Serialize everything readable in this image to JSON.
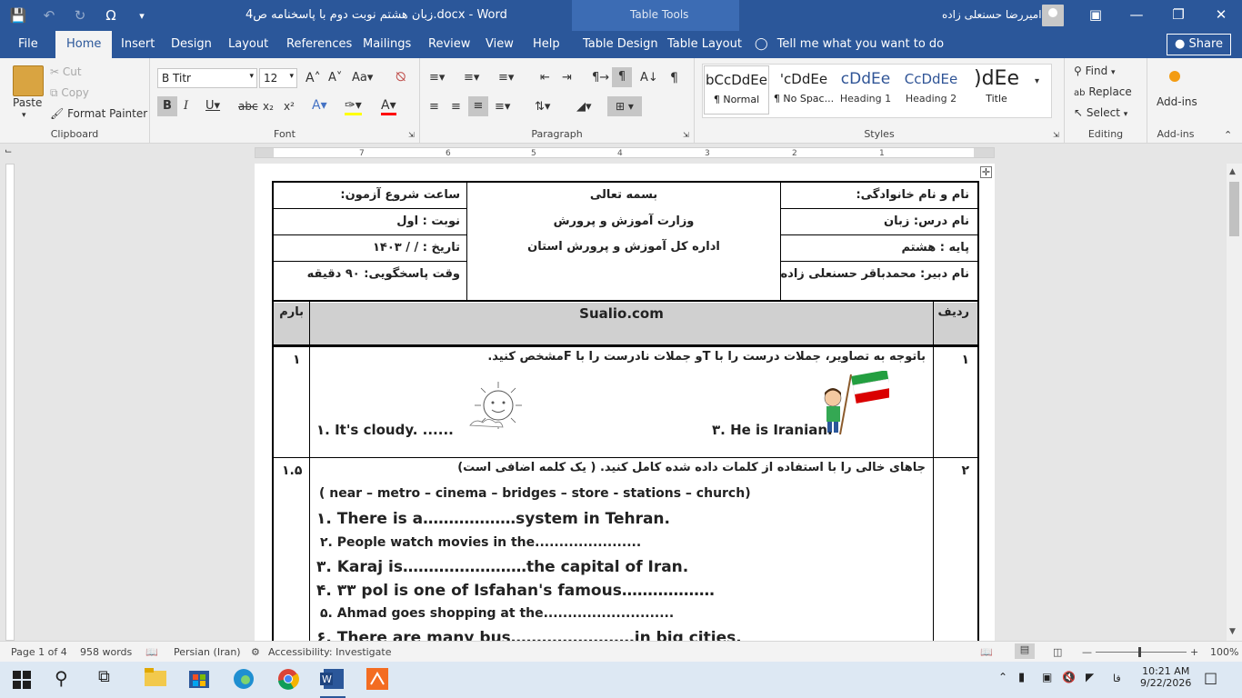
{
  "titlebar": {
    "doc_title": "زبان هشتم نوبت دوم با پاسخنامه ص4.docx  -  Word",
    "tools_title": "Table Tools",
    "user_name": "امیررضا حسنعلی زاده"
  },
  "tabs": [
    "File",
    "Home",
    "Insert",
    "Design",
    "Layout",
    "References",
    "Mailings",
    "Review",
    "View",
    "Help",
    "Table Design",
    "Table Layout"
  ],
  "tell_me": "Tell me what you want to do",
  "share_label": "Share",
  "ribbon": {
    "clipboard": {
      "label": "Clipboard",
      "paste": "Paste",
      "cut": "Cut",
      "copy": "Copy",
      "format_painter": "Format Painter"
    },
    "font": {
      "label": "Font",
      "font_name": "B Titr",
      "font_size": "12"
    },
    "paragraph": {
      "label": "Paragraph"
    },
    "styles": {
      "label": "Styles",
      "items": [
        {
          "preview": "bCcDdEe",
          "name": "¶ Normal"
        },
        {
          "preview": "'cDdEe",
          "name": "¶ No Spac..."
        },
        {
          "preview": "cDdEe",
          "name": "Heading 1"
        },
        {
          "preview": "CcDdEe",
          "name": "Heading 2"
        },
        {
          "preview": ")dEe",
          "name": "Title"
        }
      ]
    },
    "editing": {
      "label": "Editing",
      "find": "Find",
      "replace": "Replace",
      "select": "Select"
    },
    "addins": {
      "label": "Add-ins",
      "button": "Add-ins"
    }
  },
  "ruler_numbers": [
    "7",
    "6",
    "5",
    "4",
    "3",
    "2",
    "1"
  ],
  "doc": {
    "header_right": [
      "نام و نام خانوادگی:",
      "نام درس: زبان",
      "پایه : هشتم",
      "نام دبیر: محمدباقر حسنعلی زاده"
    ],
    "header_mid": [
      "بسمه تعالی",
      "وزارت آموزش و پرورش",
      "اداره کل آموزش و پرورش استان"
    ],
    "header_left": [
      "ساعت شروع آزمون:",
      "نوبت   : اول",
      "تاریخ   :      /     /   ۱۴۰۳",
      "وقت پاسخگویی: ۹۰ دقیقه"
    ],
    "col_row": "ردیف",
    "col_site": "Sualio.com",
    "col_score": "بارم",
    "q1": {
      "num": "۱",
      "score": "۱",
      "instruction": "باتوجه به تصاویر، جملات درست را با Tو جملات نادرست را با Fمشخص کنید.",
      "item_a": "۳. He is Iranian.",
      "item_b": "۱. It's cloudy. ......"
    },
    "q2": {
      "num": "۲",
      "score": "۱.۵",
      "instruction": "جاهای خالی را با استفاده از کلمات داده شده کامل کنید. ( یک کلمه اضافی است)",
      "words": "( near – metro – cinema – bridges – store -  stations – church)",
      "lines": [
        "۱. There is a………………system in Tehran.",
        "۲. People watch movies in the......................",
        "۳. Karaj is……………………the capital of Iran.",
        "۴. ۳۳ pol is one of Isfahan's famous………………",
        "۵. Ahmad goes shopping at the...........................",
        "۶. There are many bus……………………in big cities."
      ]
    }
  },
  "status": {
    "page": "Page 1 of 4",
    "words": "958 words",
    "language": "Persian (Iran)",
    "accessibility": "Accessibility: Investigate",
    "zoom": "100%"
  },
  "taskbar": {
    "time": "10:21 AM",
    "date": "9/22/2026",
    "lang": "فا"
  }
}
